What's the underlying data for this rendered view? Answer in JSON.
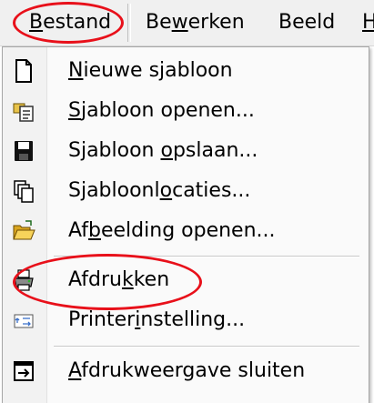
{
  "menubar": {
    "items": [
      {
        "label": "Bestand",
        "mnemonic_index": 0
      },
      {
        "label": "Bewerken",
        "mnemonic_index": 2
      },
      {
        "label": "Beeld",
        "mnemonic_index": -1
      },
      {
        "label": "H",
        "mnemonic_index": 0
      }
    ]
  },
  "menu": {
    "items": [
      {
        "label": "Nieuwe sjabloon",
        "mnemonic_index": 0,
        "icon": "new-document-icon"
      },
      {
        "label": "Sjabloon openen...",
        "mnemonic_index": 0,
        "icon": "open-template-icon"
      },
      {
        "label": "Sjabloon opslaan...",
        "mnemonic_index": 9,
        "icon": "save-disk-icon"
      },
      {
        "label": "Sjabloonlocaties...",
        "mnemonic_index": 9,
        "icon": "template-locations-icon"
      },
      {
        "label": "Afbeelding openen...",
        "mnemonic_index": 2,
        "icon": "open-folder-icon"
      },
      {
        "label": "Afdrukken",
        "mnemonic_index": 5,
        "icon": "printer-icon"
      },
      {
        "label": "Printerinstelling...",
        "mnemonic_index": 7,
        "icon": "printer-setup-icon"
      },
      {
        "label": "Afdrukweergave sluiten",
        "mnemonic_index": 0,
        "icon": "close-preview-icon"
      }
    ]
  },
  "highlight_color": "#e8101a"
}
